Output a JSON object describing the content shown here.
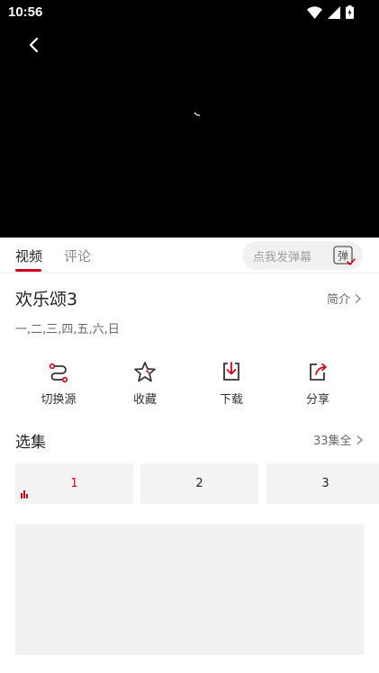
{
  "status_bar": {
    "time": "10:56"
  },
  "tabs": [
    {
      "label": "视频",
      "active": true
    },
    {
      "label": "评论",
      "active": false
    }
  ],
  "danmu": {
    "placeholder": "点我发弹幕",
    "button_label": "弹"
  },
  "show": {
    "title": "欢乐颂3",
    "intro_label": "简介",
    "days": "一,二,三,四,五,六,日"
  },
  "actions": [
    {
      "label": "切换源",
      "icon": "switch-source-icon"
    },
    {
      "label": "收藏",
      "icon": "star-icon"
    },
    {
      "label": "下载",
      "icon": "download-icon"
    },
    {
      "label": "分享",
      "icon": "share-icon"
    }
  ],
  "episodes": {
    "title": "选集",
    "all_label": "33集全",
    "items": [
      {
        "label": "1",
        "active": true
      },
      {
        "label": "2",
        "active": false
      },
      {
        "label": "3",
        "active": false
      }
    ]
  },
  "colors": {
    "accent": "#d0021b",
    "video_bg": "#000000",
    "tile_bg": "#f3f3f3"
  }
}
